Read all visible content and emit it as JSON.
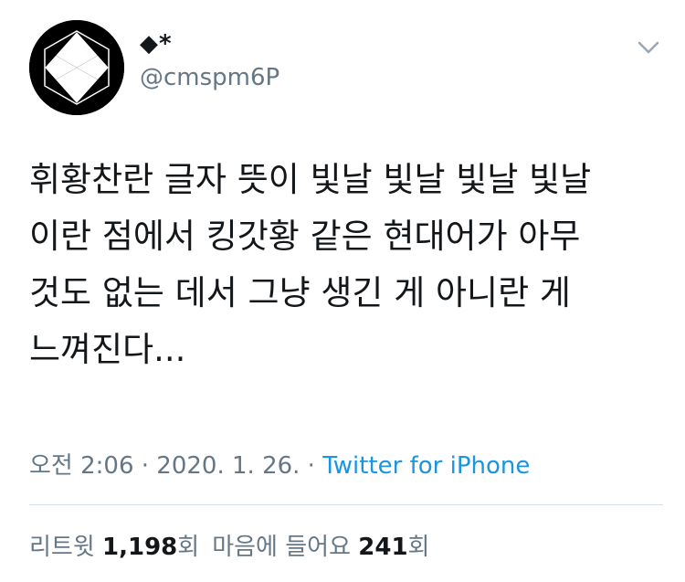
{
  "author": {
    "display_name": "◆*",
    "handle": "@cmspm6P"
  },
  "tweet": {
    "lines": [
      "휘황찬란 글자 뜻이 빛날 빛날 빛날 빛날",
      "이란 점에서 킹갓황 같은 현대어가 아무",
      "것도 없는 데서 그냥 생긴 게 아니란 게",
      "느껴진다..."
    ]
  },
  "meta": {
    "time": "오전 2:06",
    "separator": " · ",
    "date": "2020. 1. 26.",
    "source": "Twitter for iPhone"
  },
  "stats": {
    "retweets_label": "리트윗",
    "retweets_count": "1,198",
    "retweets_unit": "회",
    "likes_label": "마음에 들어요",
    "likes_count": "241",
    "likes_unit": "회"
  },
  "icons": {
    "avatar": "hexagon-diamond-logo",
    "menu": "chevron-down-icon"
  },
  "colors": {
    "text": "#14171a",
    "secondary": "#657786",
    "link": "#1b95e0",
    "divider": "#d8dfe5",
    "avatar_bg": "#000000"
  }
}
